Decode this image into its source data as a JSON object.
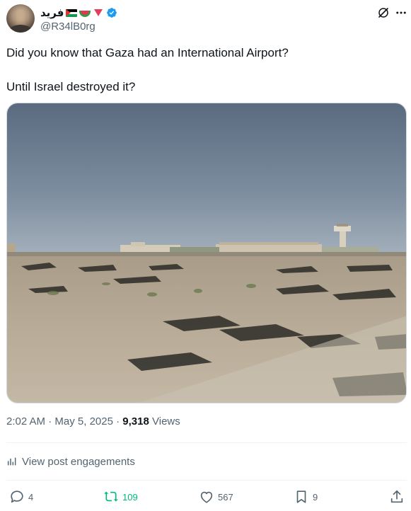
{
  "author": {
    "display_name": "فريد",
    "handle": "@R34lB0rg",
    "emoji": [
      "palestine-flag",
      "watermelon",
      "red-triangle"
    ],
    "verified": true
  },
  "tweet": {
    "line1": "Did you know that Gaza had an International Airport?",
    "line2": "Until Israel destroyed it?"
  },
  "meta": {
    "time": "2:02 AM",
    "separator1": " · ",
    "date": "May 5, 2025",
    "separator2": " · ",
    "views_count": "9,318",
    "views_label": " Views"
  },
  "engagements": {
    "label": "View post engagements"
  },
  "actions": {
    "replies": "4",
    "reposts": "109",
    "likes": "567",
    "bookmarks": "9"
  },
  "colors": {
    "text": "#0f1419",
    "secondary": "#536471",
    "verified": "#1d9bf0",
    "repost": "#00ba7c",
    "border": "#cfd9de"
  }
}
